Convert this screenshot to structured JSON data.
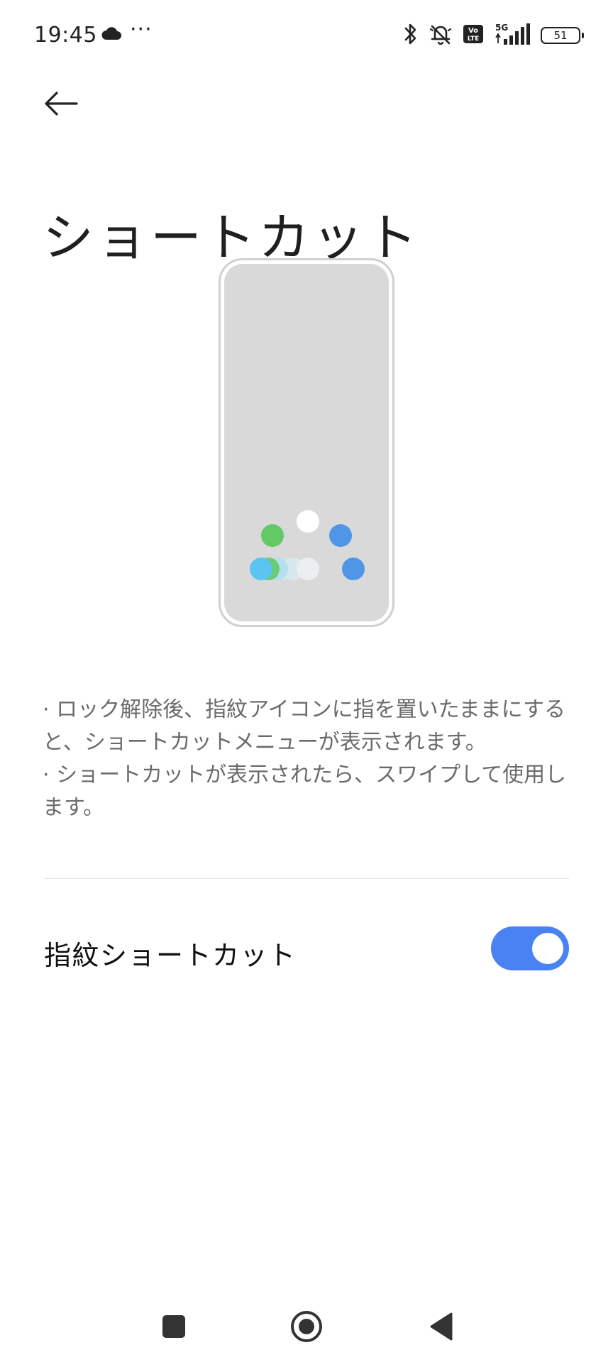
{
  "status_bar": {
    "time": "19:45",
    "more": "···",
    "network_label": "5G",
    "volte_label": "Vo LTE",
    "battery": "51"
  },
  "page": {
    "title": "ショートカット"
  },
  "description": {
    "line1": "· ロック解除後、指紋アイコンに指を置いたままにすると、ショートカットメニューが表示されます。",
    "line2": "· ショートカットが表示されたら、スワイプして使用します。"
  },
  "setting": {
    "label": "指紋ショートカット",
    "enabled": true
  },
  "colors": {
    "accent": "#4a82f4",
    "dot_green": "#62c965",
    "dot_blue": "#4f96e6",
    "dot_cyan": "#5bc4f0",
    "phone_screen": "#d9d9d9"
  },
  "icons": {
    "back": "arrow-left-icon",
    "cloud": "cloud-icon",
    "bluetooth": "bluetooth-icon",
    "mute": "bell-off-icon",
    "signal": "signal-icon",
    "nav_recent": "square-icon",
    "nav_home": "circle-icon",
    "nav_back": "triangle-icon"
  }
}
